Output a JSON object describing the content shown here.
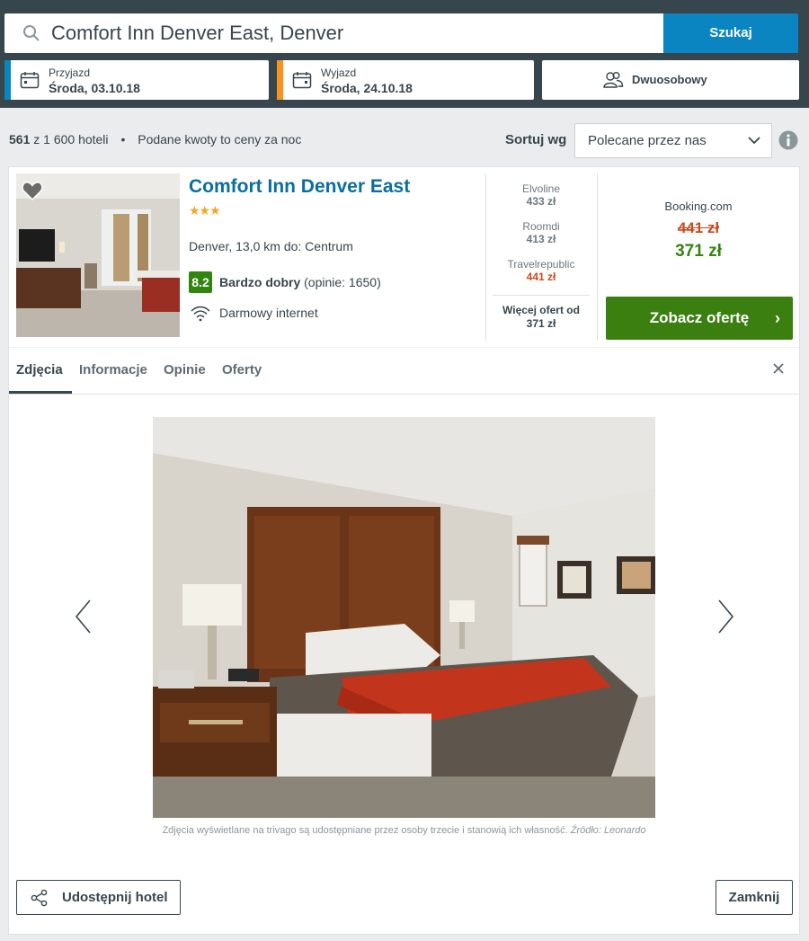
{
  "search": {
    "value": "Comfort Inn Denver East, Denver",
    "button_label": "Szukaj"
  },
  "checkin": {
    "label": "Przyjazd",
    "value": "Środa, 03.10.18",
    "accent": "#0a85c2"
  },
  "checkout": {
    "label": "Wyjazd",
    "value": "Środa, 24.10.18",
    "accent": "#f7931e"
  },
  "room": {
    "label": "Dwuosobowy"
  },
  "results": {
    "count": "561",
    "of_total": "z 1 600 hoteli",
    "separator": "•",
    "note": "Podane kwoty to ceny za noc"
  },
  "sort": {
    "label": "Sortuj wg",
    "selected": "Polecane przez nas"
  },
  "hotel": {
    "name": "Comfort Inn Denver East",
    "stars": "★★★",
    "location": "Denver, 13,0 km do: Centrum",
    "rating_score": "8.2",
    "rating_label": "Bardzo dobry",
    "rating_reviews": "(opinie: 1650)",
    "amenity": "Darmowy internet"
  },
  "partners": [
    {
      "name": "Elvoline",
      "price": "433 zł"
    },
    {
      "name": "Roomdi",
      "price": "413 zł"
    },
    {
      "name": "Travelrepublic",
      "price": "441 zł"
    }
  ],
  "more_offers": {
    "line1": "Więcej ofert od",
    "line2": "371 zł"
  },
  "deal": {
    "provider": "Booking.com",
    "old_price": "441 zł",
    "new_price": "371 zł",
    "button_label": "Zobacz ofertę",
    "button_arrow": "›"
  },
  "tabs": [
    "Zdjęcia",
    "Informacje",
    "Opinie",
    "Oferty"
  ],
  "gallery": {
    "credit": "Zdjęcia wyświetlane na trivago są udostępniane przez osoby trzecie i stanowią ich własność.",
    "source": "Źródło: Leonardo"
  },
  "actions": {
    "share_label": "Udostępnij hotel",
    "close_label": "Zamknij"
  },
  "colors": {
    "header_bg": "#37454d",
    "search_button": "#0a85c2",
    "offer_button": "#3a7f10",
    "rating_badge": "#31850f",
    "old_price": "#c94a1e",
    "hotel_name": "#0a6e9e"
  }
}
